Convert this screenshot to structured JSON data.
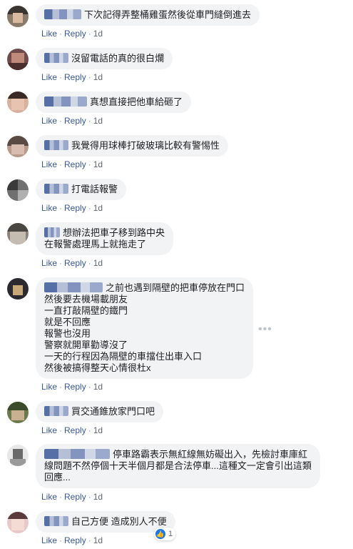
{
  "actions": {
    "like": "Like",
    "reply": "Reply",
    "time": "1d",
    "dot": "·"
  },
  "comments": [
    {
      "lines": [
        "下次記得弄整桶雞蛋然後從車門縫倒進去"
      ]
    },
    {
      "lines": [
        "沒留電話的真的很白爛"
      ]
    },
    {
      "lines": [
        "真想直接把他車給砸了"
      ]
    },
    {
      "lines": [
        "我覺得用球棒打破玻璃比較有警惕性"
      ]
    },
    {
      "lines": [
        "打電話報警"
      ]
    },
    {
      "lines": [
        "想辦法把車子移到路中央",
        "在報警處理馬上就拖走了"
      ]
    },
    {
      "lines": [
        "之前也遇到隔壁的把車停放在門口",
        "然後要去機場載朋友",
        "一直打敲隔壁的鐵門",
        "就是不回應",
        "報警也沒用",
        "警察就開單勸導沒了",
        "一天的行程因為隔壁的車擋住出車入口",
        "然後被搞得整天心情很杜x"
      ]
    },
    {
      "lines": [
        "買交通錐放家門口吧"
      ]
    },
    {
      "lines": [
        "停車路霸表示無紅線無妨礙出入，先檢討車庫紅",
        "線問題不然停個十天半個月都是合法停車...這種文一定會引出這類",
        "回應..."
      ]
    },
    {
      "lines": [
        "自己方便 造成別人不便"
      ]
    }
  ],
  "reactions": {
    "count": "1",
    "icon": "thumbs-up-icon"
  },
  "colors": {
    "link": "#385898",
    "bubble": "#f2f3f5",
    "meta": "#606770",
    "like_blue": "#1877f2"
  }
}
